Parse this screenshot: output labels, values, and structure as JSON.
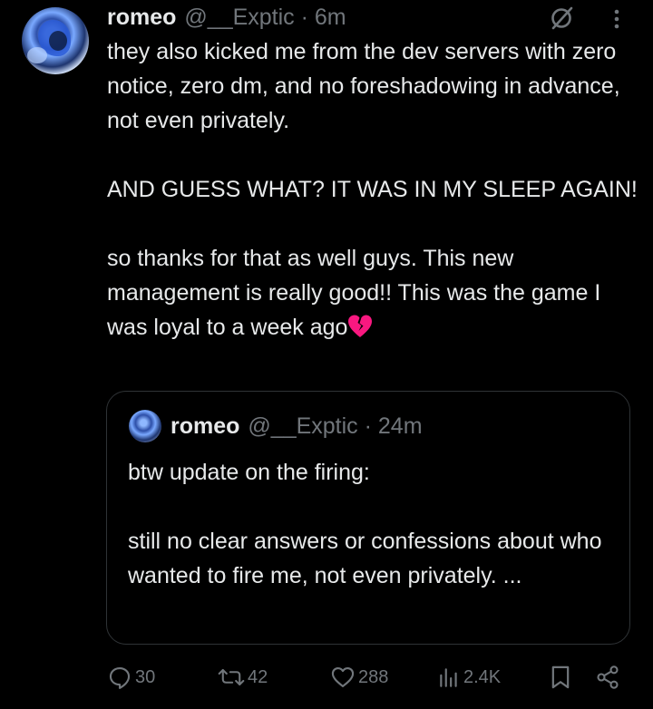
{
  "post": {
    "author_name": "romeo",
    "handle_time": "@__Exptic · 6m",
    "text": "they also kicked me from the dev servers with zero notice, zero dm, and no foreshadowing in advance, not even privately.\n\nAND GUESS WHAT? IT WAS IN MY SLEEP AGAIN!\n\nso thanks for that as well guys. This new management is really good!! This was the game I was loyal to a week ago"
  },
  "quote": {
    "author_name": "romeo",
    "handle_time": "@__Exptic · 24m",
    "text": "btw update on the firing:\n\nstill no clear answers or confessions about who wanted to fire me, not even privately. ..."
  },
  "actions": {
    "replies": "30",
    "reposts": "42",
    "likes": "288",
    "views": "2.4K"
  },
  "icons": [
    "grok-icon",
    "more-icon",
    "broken-heart-emoji",
    "reply-icon",
    "repost-icon",
    "like-icon",
    "views-icon",
    "bookmark-icon",
    "share-icon"
  ],
  "colors": {
    "background": "#000000",
    "text": "#e7e9ea",
    "muted": "#71767b",
    "border": "#2f3336",
    "broken_heart": "#f91880"
  }
}
